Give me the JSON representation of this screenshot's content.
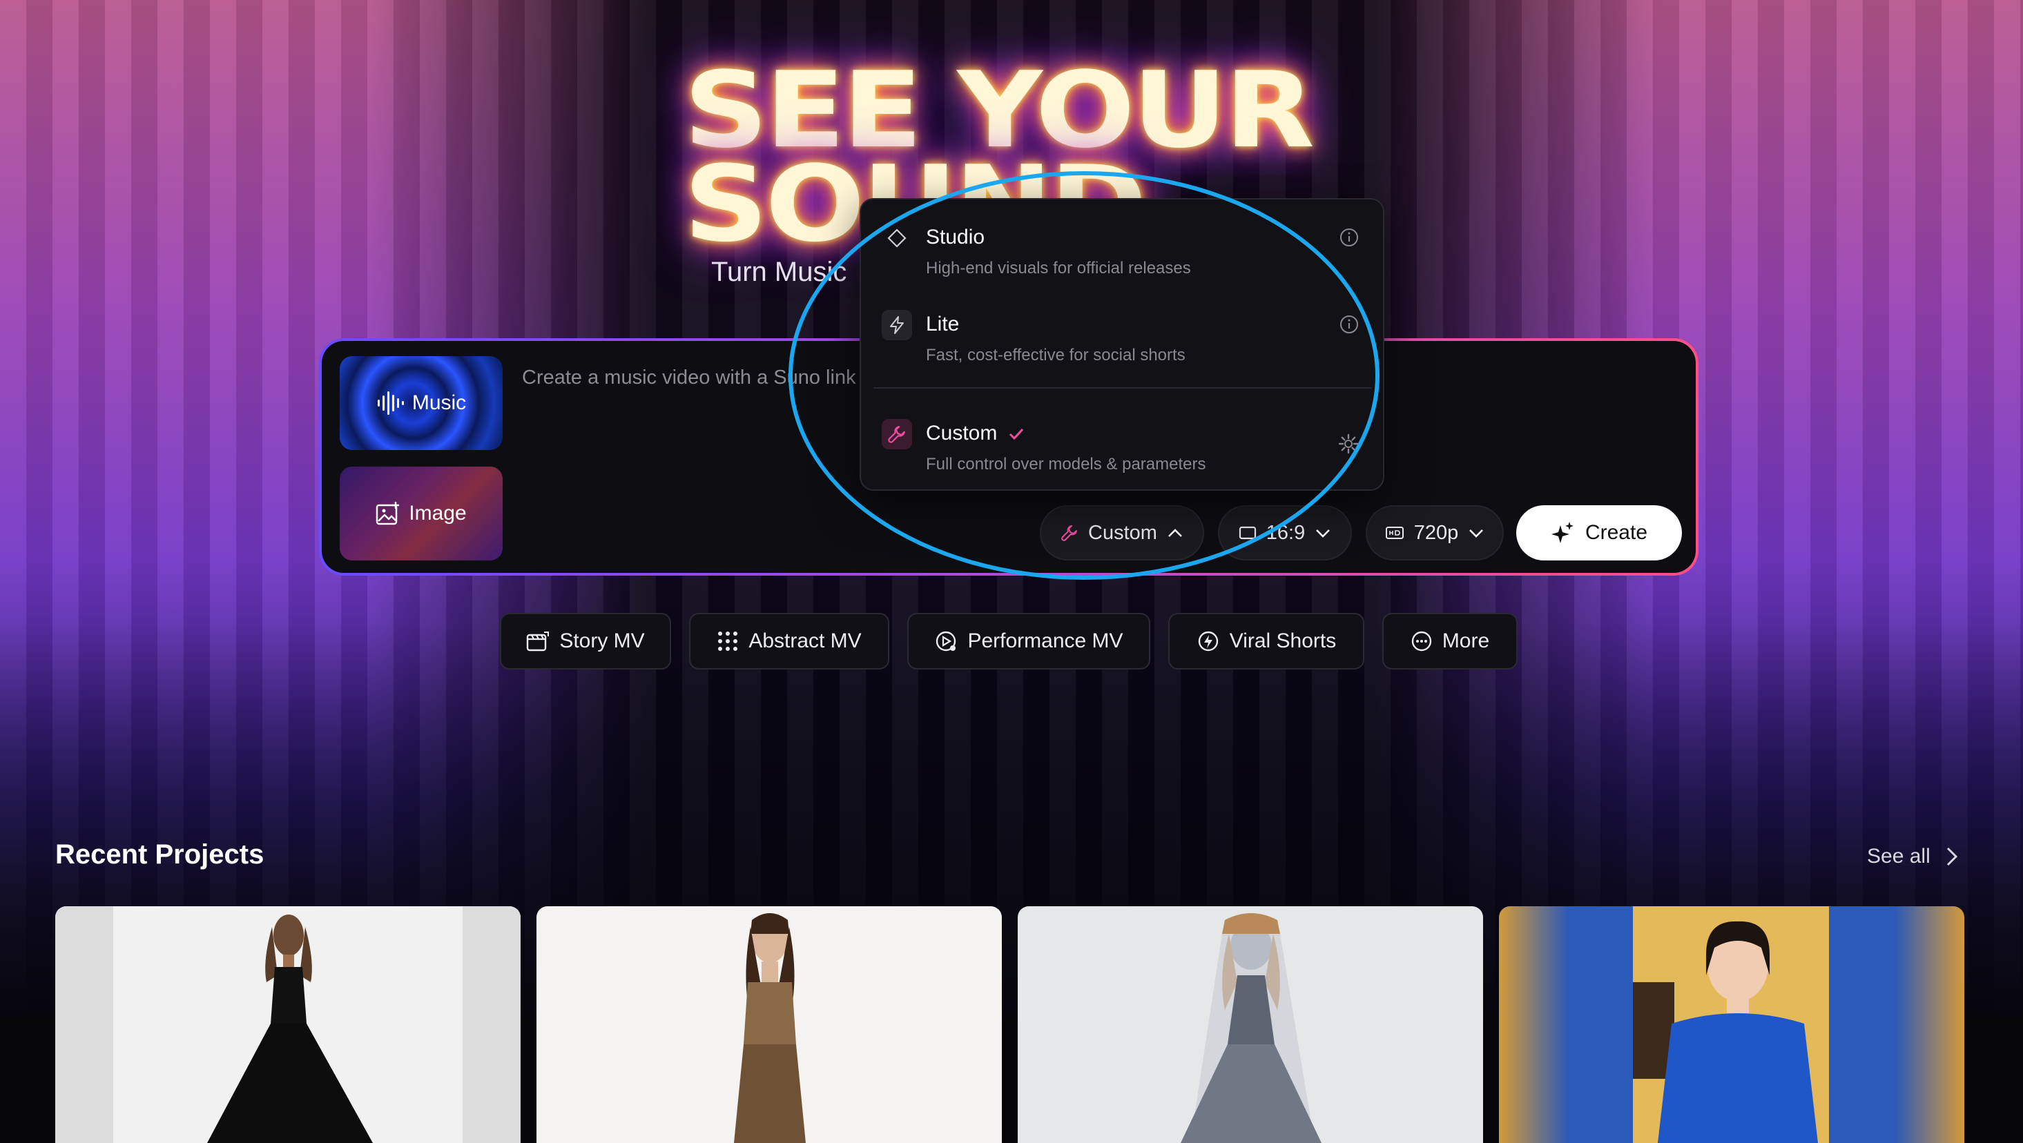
{
  "hero": {
    "headline_line1": "SEE YOUR",
    "headline_line2": "SOUND",
    "subheadline": "Turn Music"
  },
  "prompt": {
    "placeholder": "Create a music video with a Suno link",
    "tiles": [
      {
        "label": "Music",
        "icon": "waveform-icon"
      },
      {
        "label": "Image",
        "icon": "image-icon"
      }
    ]
  },
  "controls": {
    "mode_label": "Custom",
    "ratio_label": "16:9",
    "resolution_label": "720p",
    "create_label": "Create"
  },
  "mode_menu": {
    "options": [
      {
        "title": "Studio",
        "description": "High-end visuals for official releases",
        "icon": "diamond-icon"
      },
      {
        "title": "Lite",
        "description": "Fast, cost-effective for social shorts",
        "icon": "lightning-icon"
      },
      {
        "title": "Custom",
        "description": "Full control over models & parameters",
        "icon": "wrench-icon",
        "selected": true
      }
    ],
    "accent_color": "#f04ea0"
  },
  "chips": [
    {
      "label": "Story MV",
      "icon": "film-icon"
    },
    {
      "label": "Abstract MV",
      "icon": "grid-icon"
    },
    {
      "label": "Performance MV",
      "icon": "performance-icon"
    },
    {
      "label": "Viral Shorts",
      "icon": "viral-icon"
    },
    {
      "label": "More",
      "icon": "more-icon"
    }
  ],
  "recent": {
    "title": "Recent Projects",
    "see_all": "See all"
  },
  "colors": {
    "annotation": "#1aa7ef",
    "panel_border_start": "#6a4bff",
    "panel_border_end": "#ff4f86"
  }
}
